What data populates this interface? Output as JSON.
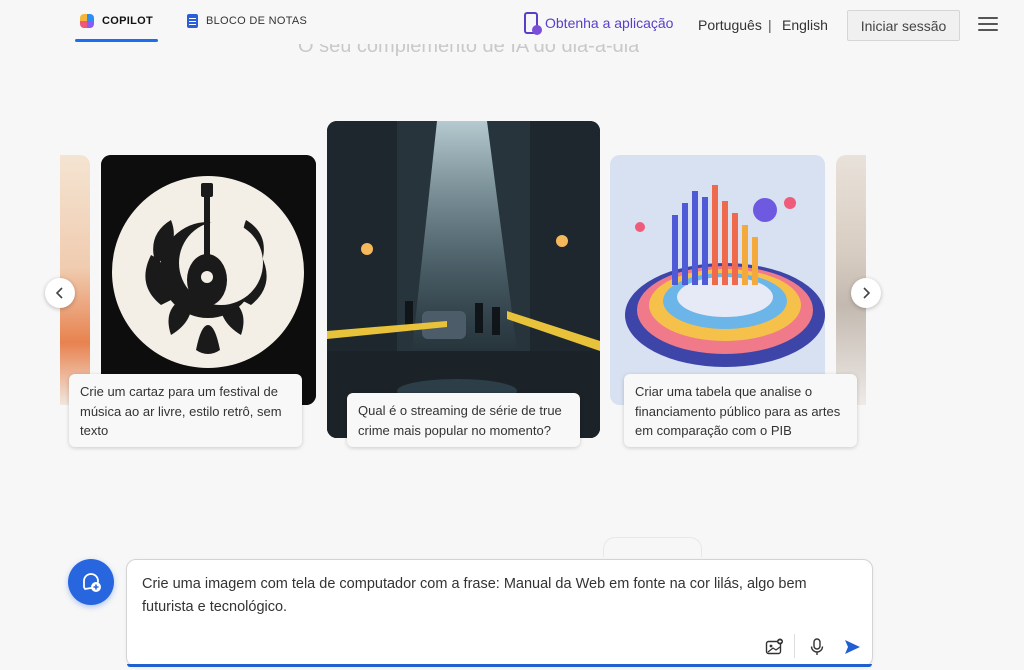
{
  "nav": {
    "tab_copilot": "COPILOT",
    "tab_notebook": "BLOCO DE NOTAS",
    "get_app": "Obtenha a aplicação",
    "lang_pt": "Português",
    "lang_sep": "|",
    "lang_en": "English",
    "sign_in": "Iniciar sessão"
  },
  "hero": {
    "subtitle": "O seu complemento de IA do dia-a-dia"
  },
  "carousel": {
    "cards": [
      {
        "caption": "Crie um cartaz para um festival de música ao ar livre, estilo retrô, sem texto",
        "icon": "guitar-moon-poster"
      },
      {
        "caption": "Qual é o streaming de série de true crime mais popular no momento?",
        "icon": "crime-scene-alley"
      },
      {
        "caption": "Criar uma tabela que analise o financiamento público para as artes em comparação com o PIB",
        "icon": "3d-data-chart"
      }
    ]
  },
  "composer": {
    "text": "Crie uma imagem com tela de computador com a frase: Manual da Web em fonte na cor lilás, algo bem futurista e tecnológico."
  },
  "colors": {
    "accent": "#1a6ff0",
    "app_link": "#5b3ec8",
    "new_topic": "#2866e0",
    "send": "#1f5fd1"
  }
}
